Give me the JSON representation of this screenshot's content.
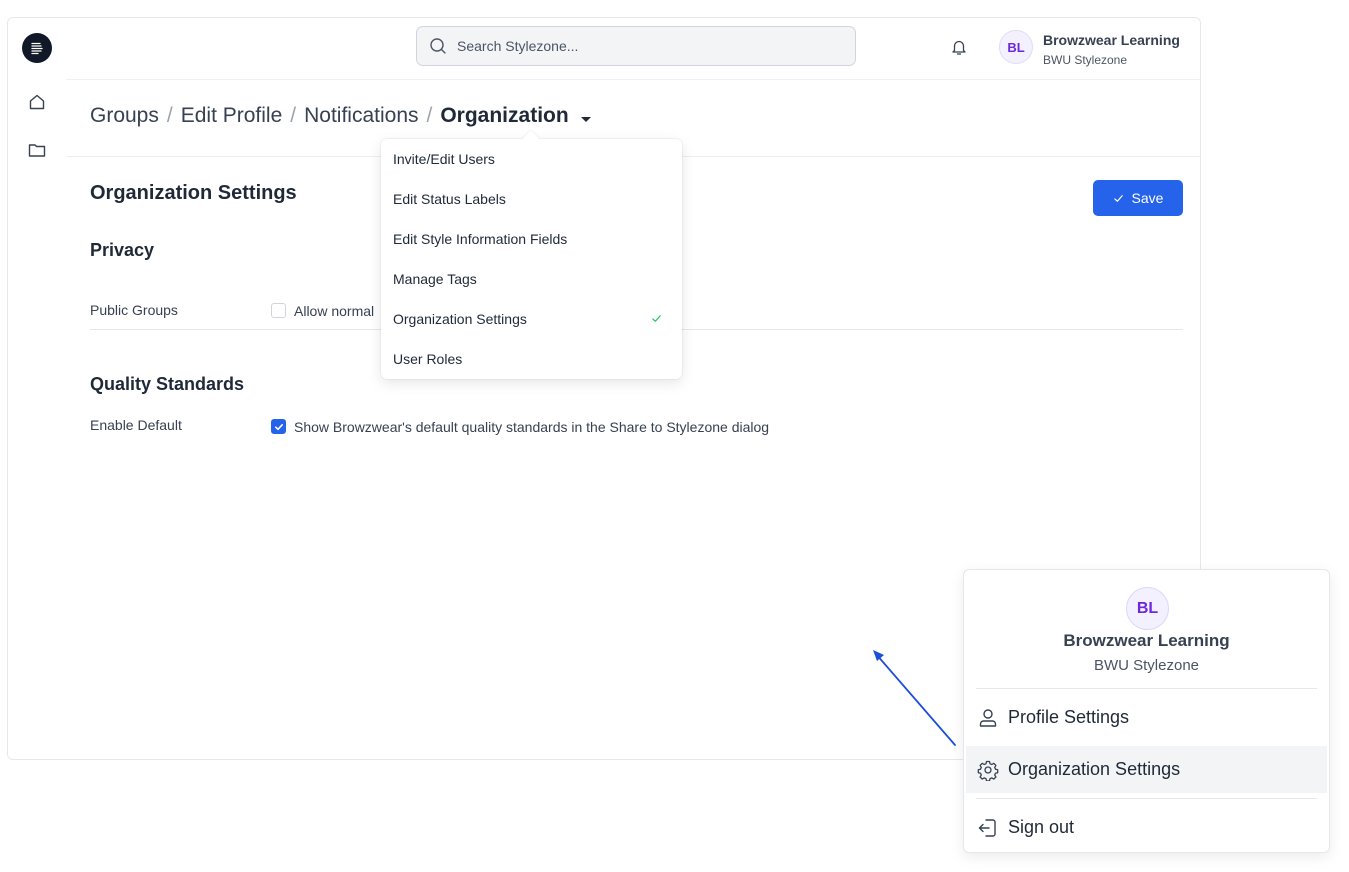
{
  "topbar": {
    "search_placeholder": "Search Stylezone...",
    "user": {
      "initials": "BL",
      "name": "Browzwear Learning",
      "org": "BWU Stylezone"
    }
  },
  "breadcrumb": {
    "items": [
      "Groups",
      "Edit Profile",
      "Notifications"
    ],
    "current": "Organization"
  },
  "page": {
    "title": "Organization Settings",
    "save_label": "Save",
    "privacy": {
      "title": "Privacy",
      "label": "Public Groups",
      "checkbox_text": "Allow normal",
      "checked": false
    },
    "quality": {
      "title": "Quality Standards",
      "label": "Enable Default",
      "checkbox_text": "Show Browzwear's default quality standards in the Share to Stylezone dialog",
      "checked": true
    }
  },
  "dropdown": {
    "items": [
      {
        "label": "Invite/Edit Users"
      },
      {
        "label": "Edit Status Labels"
      },
      {
        "label": "Edit Style Information Fields"
      },
      {
        "label": "Manage Tags"
      },
      {
        "label": "Organization Settings",
        "selected": true
      },
      {
        "label": "User Roles"
      }
    ]
  },
  "user_menu": {
    "initials": "BL",
    "name": "Browzwear Learning",
    "org": "BWU Stylezone",
    "items": [
      {
        "label": "Profile Settings",
        "icon": "user-icon"
      },
      {
        "label": "Organization Settings",
        "icon": "gear-icon",
        "active": true
      },
      {
        "label": "Sign out",
        "icon": "sign-out-icon"
      }
    ]
  },
  "colors": {
    "accent": "#2563eb",
    "avatar_text": "#6d28d9",
    "check_green": "#22c55e",
    "annotation_arrow": "#1d4ed8"
  }
}
